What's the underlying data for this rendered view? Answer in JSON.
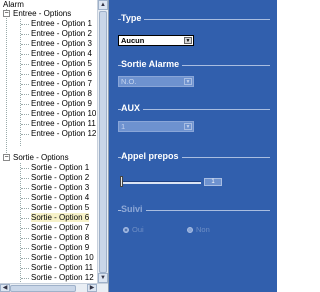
{
  "tree": {
    "root": "Alarm",
    "groups": [
      {
        "label": "Entree - Options",
        "items": [
          "Entree - Option 1",
          "Entree - Option 2",
          "Entree - Option 3",
          "Entree - Option 4",
          "Entree - Option 5",
          "Entree - Option 6",
          "Entree - Option 7",
          "Entree - Option 8",
          "Entree - Option 9",
          "Entree - Option 10",
          "Entree - Option 11",
          "Entree - Option 12"
        ]
      },
      {
        "label": "Sortie - Options",
        "items": [
          "Sortie - Option 1",
          "Sortie - Option 2",
          "Sortie - Option 3",
          "Sortie - Option 4",
          "Sortie - Option 5",
          "Sortie - Option 6",
          "Sortie - Option 7",
          "Sortie - Option 8",
          "Sortie - Option 9",
          "Sortie - Option 10",
          "Sortie - Option 11",
          "Sortie - Option 12"
        ]
      }
    ],
    "selected_item": "Sortie - Option 6",
    "collapse_glyph": "−"
  },
  "scroll": {
    "up": "▲",
    "down": "▼",
    "left": "◀",
    "right": "▶"
  },
  "panel": {
    "type": {
      "title": "Type",
      "value": "Aucun"
    },
    "sortie_alarme": {
      "title": "Sortie Alarme",
      "value": "N.O."
    },
    "aux": {
      "title": "AUX",
      "value": "1"
    },
    "appel_prepos": {
      "title": "Appel prepos",
      "value": "1"
    },
    "suivi": {
      "title": "Suivi",
      "options": [
        "Oui",
        "Non"
      ]
    },
    "combo_arrow": "▼"
  },
  "colors": {
    "panel_bg": "#315fad",
    "selection": "#f7f2c8",
    "disabled_field": "#6e92cf"
  }
}
